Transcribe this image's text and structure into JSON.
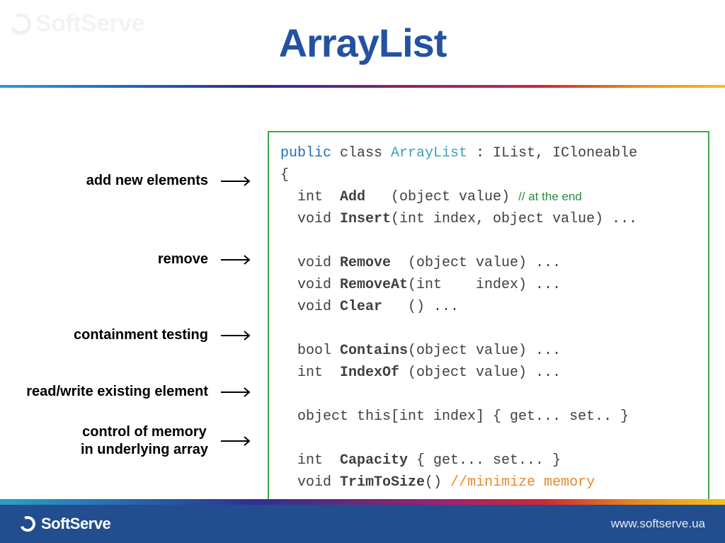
{
  "watermark": "SoftServe",
  "title": "ArrayList",
  "annotations": {
    "add": "add new elements",
    "remove": "remove",
    "contain": "containment testing",
    "readwrite": "read/write existing element",
    "memory1": "control of memory",
    "memory2": "in underlying array"
  },
  "code": {
    "l01a": "public",
    "l01b": " class ",
    "l01c": "ArrayList",
    "l01d": " : IList, ICloneable",
    "l02": "{",
    "l03a": "  int  ",
    "l03b": "Add",
    "l03c": "   (object value) ",
    "l03d": "// at the end",
    "l04a": "  void ",
    "l04b": "Insert",
    "l04c": "(int index, object value) ...",
    "l05": "",
    "l06a": "  void ",
    "l06b": "Remove",
    "l06c": "  (object value) ...",
    "l07a": "  void ",
    "l07b": "RemoveAt",
    "l07c": "(int    index) ...",
    "l08a": "  void ",
    "l08b": "Clear",
    "l08c": "   () ...",
    "l09": "",
    "l10a": "  bool ",
    "l10b": "Contains",
    "l10c": "(object value) ...",
    "l11a": "  int  ",
    "l11b": "IndexOf",
    "l11c": " (object value) ...",
    "l12": "",
    "l13": "  object this[int index] { get... set.. }",
    "l14": "",
    "l15a": "  int  ",
    "l15b": "Capacity",
    "l15c": " { get... set... }",
    "l16a": "  void ",
    "l16b": "TrimToSize",
    "l16c": "() ",
    "l16d": "//minimize memory",
    "l17": "  ...",
    "l18": "}"
  },
  "footer": {
    "brand": "SoftServe",
    "url": "www.softserve.ua"
  }
}
